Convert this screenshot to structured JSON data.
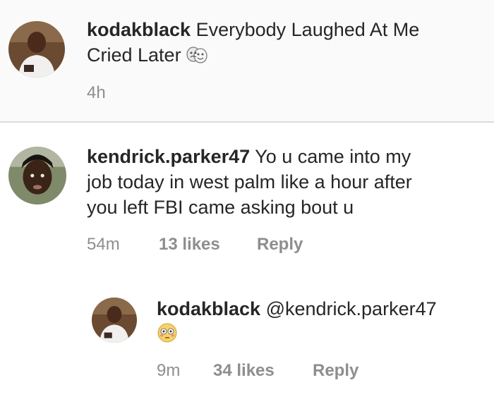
{
  "caption": {
    "username": "kodakblack",
    "text_line1": "Everybody Laughed At Me",
    "text_line2": "Cried Later",
    "emoji_icon": "theater-masks-icon",
    "time": "4h"
  },
  "comment": {
    "username": "kendrick.parker47",
    "text_line1": "Yo u came into my",
    "text_line2": "job today in west palm like a hour after",
    "text_line3": "you left FBI came asking bout u",
    "time": "54m",
    "likes": "13 likes",
    "reply": "Reply"
  },
  "reply": {
    "username": "kodakblack",
    "mention": "@kendrick.parker47",
    "emoji_icon": "flushed-face-icon",
    "time": "9m",
    "likes": "34 likes",
    "reply": "Reply"
  },
  "colors": {
    "text": "#262626",
    "meta": "#8e8e8e",
    "caption_bg": "#fafafa",
    "divider": "#dcdcdc"
  }
}
